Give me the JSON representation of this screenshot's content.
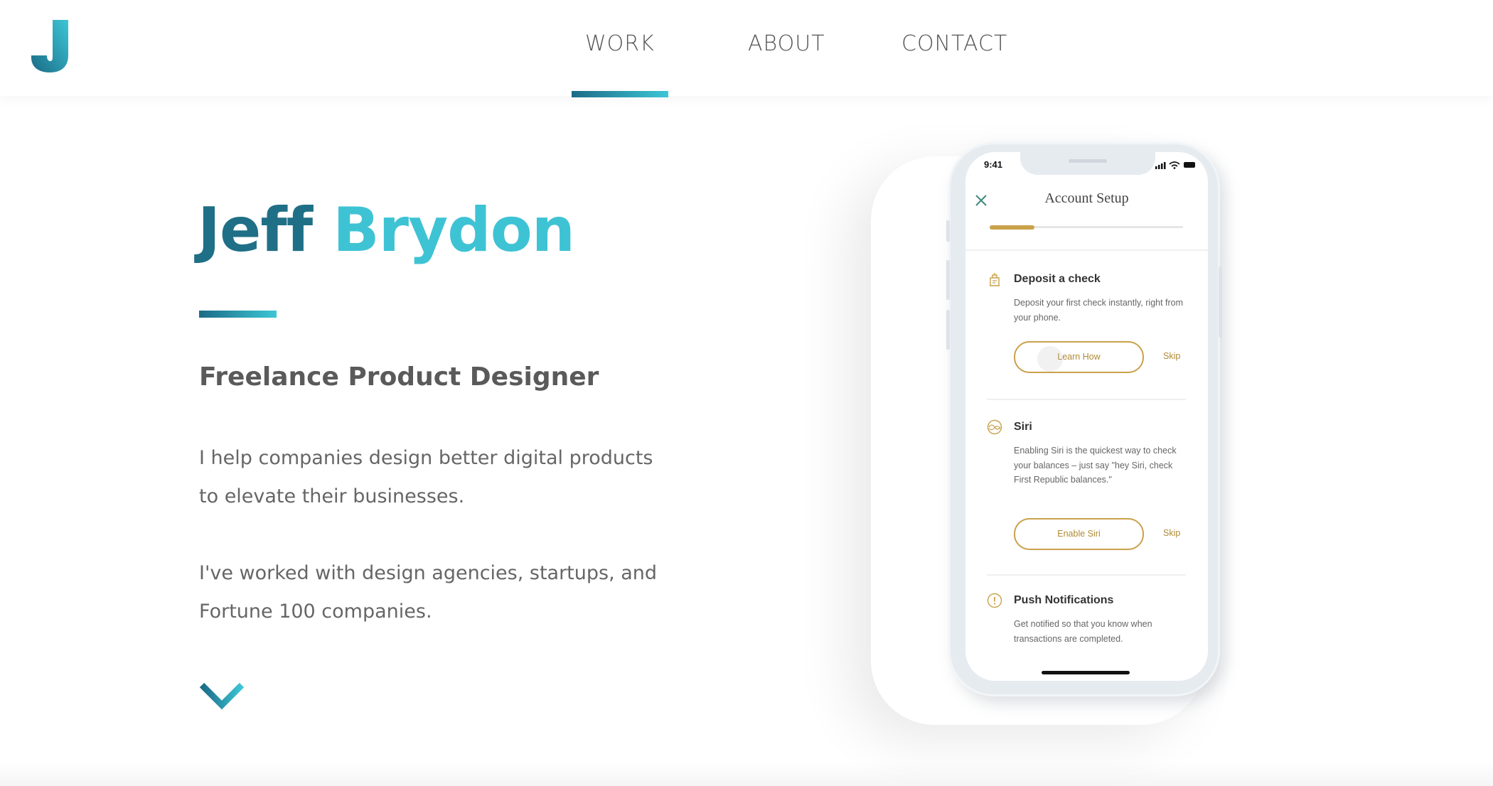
{
  "header": {
    "nav": [
      {
        "label": "WORK",
        "active": true
      },
      {
        "label": "ABOUT",
        "active": false
      },
      {
        "label": "CONTACT",
        "active": false
      }
    ],
    "logo_icon": "j-monogram-logo"
  },
  "hero": {
    "first_name": "Jeff",
    "last_name": "Brydon",
    "subtitle": "Freelance Product Designer",
    "paragraph1": "I help companies design better digital products to elevate their businesses.",
    "paragraph2": "I've worked with design agencies, startups, and Fortune 100 companies.",
    "scroll_icon": "chevron-down-icon"
  },
  "phone": {
    "status_time": "9:41",
    "screen_title": "Account Setup",
    "progress": 0.23,
    "cards": [
      {
        "icon": "bank-check-icon",
        "title": "Deposit a check",
        "description": "Deposit your first check instantly, right from your phone.",
        "button": "Learn How",
        "skip": "Skip"
      },
      {
        "icon": "siri-icon",
        "title": "Siri",
        "description": "Enabling Siri is the quickest way to check your balances – just say \"hey Siri, check First Republic balances.\"",
        "button": "Enable Siri",
        "skip": "Skip"
      },
      {
        "icon": "alert-circle-icon",
        "title": "Push Notifications",
        "description": "Get notified so that you know when transactions are completed."
      }
    ]
  },
  "colors": {
    "brand_dark": "#1f6f86",
    "brand_light": "#3ec3d4",
    "accent_gold": "#c9a14a"
  }
}
